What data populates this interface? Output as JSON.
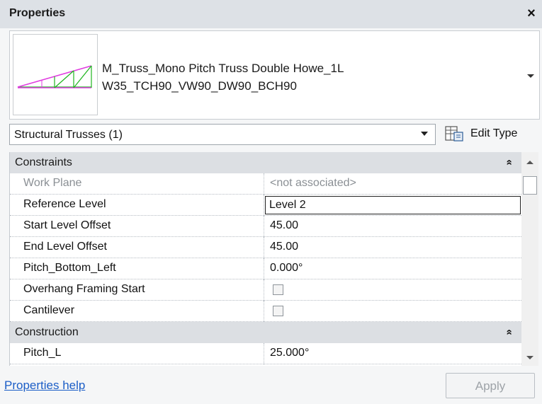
{
  "panel": {
    "title": "Properties",
    "close_symbol": "×"
  },
  "type_selector": {
    "name_line1": "M_Truss_Mono Pitch Truss Double Howe_1L",
    "name_line2": "W35_TCH90_VW90_DW90_BCH90",
    "thumbnail_icon": "truss-preview-icon",
    "dropdown_icon": "dropdown-arrow-icon"
  },
  "category_selector": {
    "value": "Structural Trusses (1)"
  },
  "edit_type": {
    "label": "Edit Type",
    "icon": "edit-type-icon"
  },
  "groups": [
    {
      "title": "Constraints",
      "collapse_symbol": "»",
      "rows": [
        {
          "name": "Work Plane",
          "value": "<not associated>",
          "enabled": false
        },
        {
          "name": "Reference Level",
          "value": "Level 2",
          "editing": true
        },
        {
          "name": "Start Level Offset",
          "value": "45.00"
        },
        {
          "name": "End Level Offset",
          "value": "45.00"
        },
        {
          "name": "Pitch_Bottom_Left",
          "value": "0.000°"
        },
        {
          "name": "Overhang Framing Start",
          "checkbox": true,
          "checked": false
        },
        {
          "name": "Cantilever",
          "checkbox": true,
          "checked": false
        }
      ]
    },
    {
      "title": "Construction",
      "collapse_symbol": "»",
      "rows": [
        {
          "name": "Pitch_L",
          "value": "25.000°"
        }
      ]
    }
  ],
  "footer": {
    "help_link": "Properties help",
    "apply_label": "Apply"
  },
  "colors": {
    "titlebar_bg": "#dde1e6",
    "group_bg": "#dcdfe3",
    "link": "#1c5ec7",
    "disabled_text": "#8a8f94"
  }
}
